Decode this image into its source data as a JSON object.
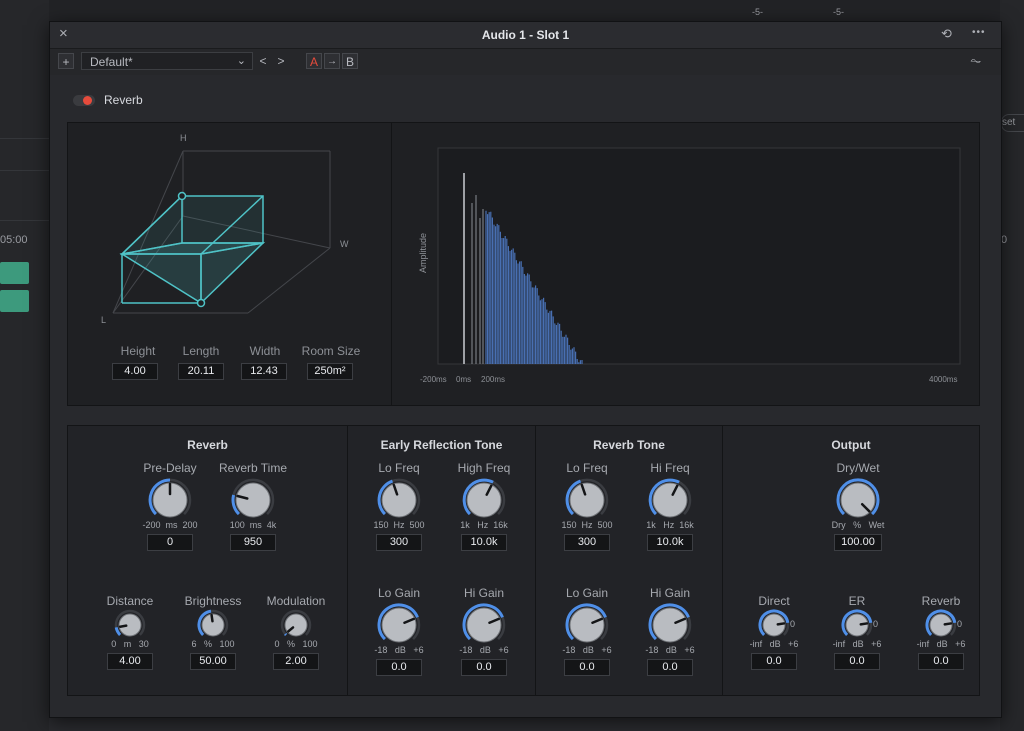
{
  "window": {
    "title": "Audio 1 - Slot 1",
    "close_glyph": "×",
    "history_glyph": "⟲",
    "more_glyph": "•••"
  },
  "toolbar": {
    "add_glyph": "+",
    "preset_value": "Default*",
    "preset_chevron": "⌄",
    "prev_glyph": "<",
    "next_glyph": ">",
    "a_label": "A",
    "copy_glyph": "→",
    "b_label": "B",
    "route_glyph": "⏦"
  },
  "background": {
    "tc_left": "05:00",
    "tc_right": "0",
    "reset_label": "set",
    "meter_marks": [
      "-5-",
      "-5-"
    ]
  },
  "plugin": {
    "name": "Reverb",
    "enabled": true,
    "colors": {
      "accent": "#4f8fe8",
      "room": "#4fc3c7",
      "power": "#e64b3c",
      "ir_bar": "#4d78c2"
    }
  },
  "room": {
    "axis_h": "H",
    "axis_w": "W",
    "axis_l": "L",
    "fields": [
      {
        "label": "Height",
        "value": "4.00"
      },
      {
        "label": "Length",
        "value": "20.11"
      },
      {
        "label": "Width",
        "value": "12.43"
      },
      {
        "label": "Room Size",
        "value": "250m²"
      }
    ]
  },
  "ir_graph": {
    "ylabel": "Amplitude",
    "ticks": [
      "-200ms",
      "0ms",
      "200ms",
      "4000ms"
    ]
  },
  "sections": {
    "reverb": {
      "title": "Reverb",
      "knobs": [
        {
          "label": "Pre-Delay",
          "range": "-200  ms  200",
          "value": "0",
          "level": 0.5
        },
        {
          "label": "Reverb Time",
          "range": "100  ms  4k",
          "value": "950",
          "level": 0.22
        },
        {
          "label": "Distance",
          "range": "0   m   30",
          "value": "4.00",
          "level": 0.13
        },
        {
          "label": "Brightness",
          "range": "6   %   100",
          "value": "50.00",
          "level": 0.47
        },
        {
          "label": "Modulation",
          "range": "0   %   100",
          "value": "2.00",
          "level": 0.02
        }
      ]
    },
    "early": {
      "title": "Early Reflection Tone",
      "knobs": [
        {
          "label": "Lo Freq",
          "range": "150  Hz  500",
          "value": "300",
          "level": 0.43
        },
        {
          "label": "High Freq",
          "range": "1k   Hz  16k",
          "value": "10.0k",
          "level": 0.6
        },
        {
          "label": "Lo Gain",
          "range": "-18   dB   +6",
          "value": "0.0",
          "level": 0.75
        },
        {
          "label": "Hi Gain",
          "range": "-18   dB   +6",
          "value": "0.0",
          "level": 0.75
        }
      ]
    },
    "tone": {
      "title": "Reverb Tone",
      "knobs": [
        {
          "label": "Lo Freq",
          "range": "150  Hz  500",
          "value": "300",
          "level": 0.43
        },
        {
          "label": "Hi Freq",
          "range": "1k   Hz  16k",
          "value": "10.0k",
          "level": 0.6
        },
        {
          "label": "Lo Gain",
          "range": "-18   dB   +6",
          "value": "0.0",
          "level": 0.75
        },
        {
          "label": "Hi Gain",
          "range": "-18   dB   +6",
          "value": "0.0",
          "level": 0.75
        }
      ]
    },
    "output": {
      "title": "Output",
      "knobs": [
        {
          "label": "Dry/Wet",
          "range": "Dry   %   Wet",
          "value": "100.00",
          "level": 1.0
        },
        {
          "label": "Direct",
          "range": "-inf   dB   +6",
          "value": "0.0",
          "level": 0.8,
          "mark": "0"
        },
        {
          "label": "ER",
          "range": "-inf   dB   +6",
          "value": "0.0",
          "level": 0.8,
          "mark": "0"
        },
        {
          "label": "Reverb",
          "range": "-inf   dB   +6",
          "value": "0.0",
          "level": 0.8,
          "mark": "0"
        }
      ]
    }
  }
}
